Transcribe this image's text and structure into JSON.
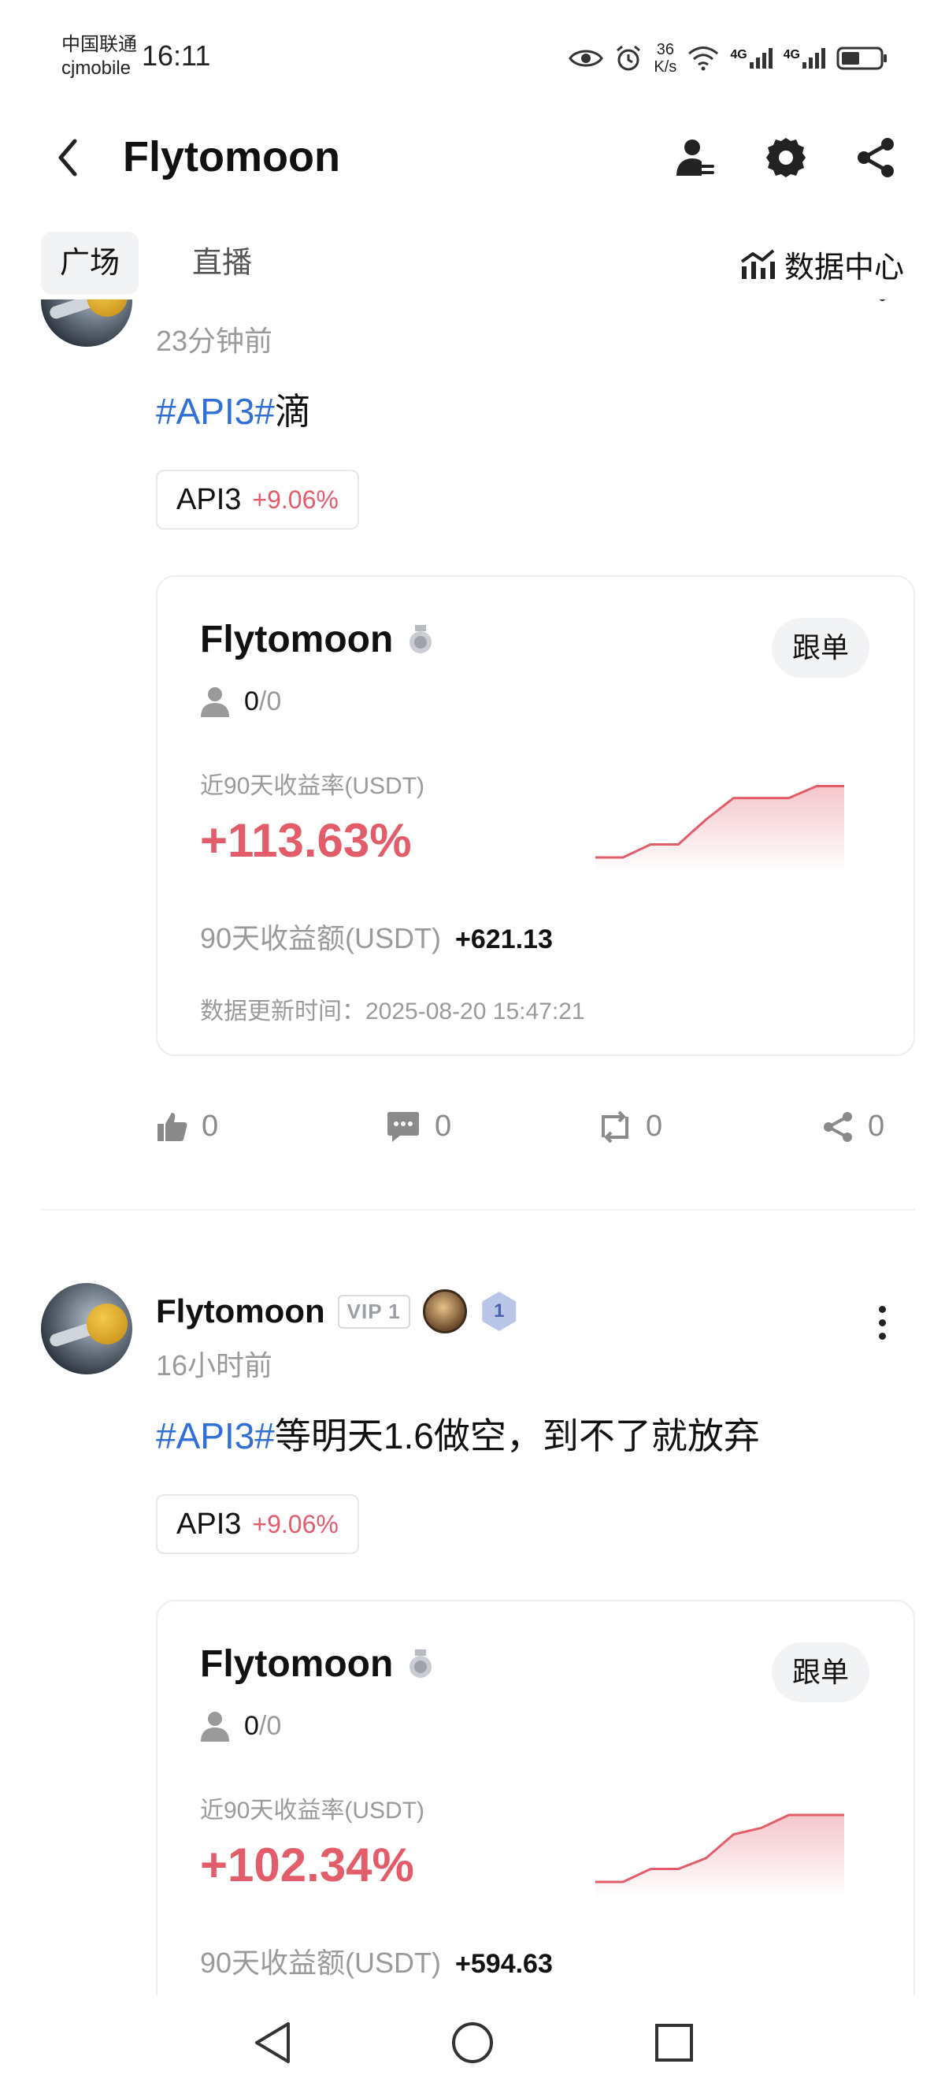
{
  "status_bar": {
    "carrier_line1": "中国联通",
    "carrier_line2": "cjmobile",
    "time": "16:11",
    "net_speed_value": "36",
    "net_speed_unit": "K/s",
    "signal1_label": "4G",
    "signal2_label": "4G"
  },
  "nav": {
    "title": "Flytomoon",
    "icons": [
      "back-icon",
      "user-manage-icon",
      "gear-icon",
      "share-icon"
    ]
  },
  "tabs": {
    "items": [
      {
        "label": "广场",
        "active": true
      },
      {
        "label": "直播",
        "active": false
      }
    ],
    "data_center_label": "数据中心"
  },
  "posts": [
    {
      "time": "23分钟前",
      "tag": "#API3#",
      "text": "滴",
      "coin": {
        "symbol": "API3",
        "change": "+9.06%"
      },
      "card": {
        "name": "Flytomoon",
        "follow_label": "跟单",
        "followers_current": "0",
        "followers_max": "/0",
        "rate_label": "近90天收益率(USDT)",
        "rate_value": "+113.63%",
        "amount_label": "90天收益额(USDT)",
        "amount_value": "+621.13",
        "update_label": "数据更新时间：",
        "update_time": "2025-08-20 15:47:21",
        "sparkline": [
          0,
          0,
          0.12,
          0.12,
          0.35,
          0.55,
          0.55,
          0.55,
          0.66,
          0.66
        ]
      },
      "actions": {
        "likes": "0",
        "comments": "0",
        "reposts": "0",
        "shares": "0"
      }
    },
    {
      "username": "Flytomoon",
      "vip": "VIP 1",
      "level": "1",
      "time": "16小时前",
      "tag": "#API3#",
      "text": "等明天1.6做空，到不了就放弃",
      "coin": {
        "symbol": "API3",
        "change": "+9.06%"
      },
      "card": {
        "name": "Flytomoon",
        "follow_label": "跟单",
        "followers_current": "0",
        "followers_max": "/0",
        "rate_label": "近90天收益率(USDT)",
        "rate_value": "+102.34%",
        "amount_label": "90天收益额(USDT)",
        "amount_value": "+594.63",
        "sparkline": [
          0,
          0,
          0.12,
          0.12,
          0.22,
          0.44,
          0.5,
          0.62,
          0.62,
          0.62
        ]
      }
    }
  ],
  "colors": {
    "hashtag": "#2f6fd6",
    "gain": "#e25c6a",
    "muted": "#9a9a9a"
  }
}
